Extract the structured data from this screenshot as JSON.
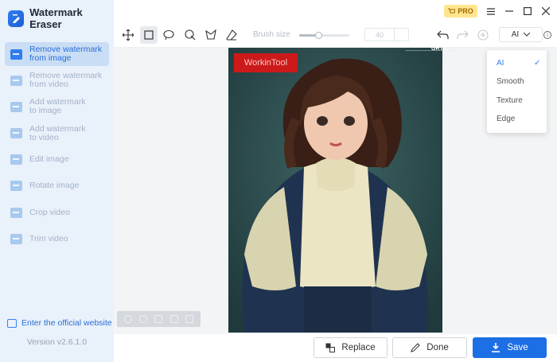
{
  "app": {
    "title": "Watermark Eraser",
    "version": "Version v2.6.1.0"
  },
  "sidebar": {
    "items": [
      {
        "label": "Remove watermark\nfrom image",
        "icon": "image-remove-icon",
        "active": true
      },
      {
        "label": "Remove watermark\nfrom video",
        "icon": "video-remove-icon",
        "active": false
      },
      {
        "label": "Add watermark\nto image",
        "icon": "image-add-icon",
        "active": false
      },
      {
        "label": "Add watermark\nto video",
        "icon": "video-add-icon",
        "active": false
      },
      {
        "label": "Edit image",
        "icon": "edit-image-icon",
        "active": false
      },
      {
        "label": "Rotate image",
        "icon": "rotate-image-icon",
        "active": false
      },
      {
        "label": "Crop video",
        "icon": "crop-video-icon",
        "active": false
      },
      {
        "label": "Trim video",
        "icon": "trim-video-icon",
        "active": false
      }
    ],
    "official_link": "Enter the official website"
  },
  "titlebar": {
    "pro_label": "PRO"
  },
  "toolbar": {
    "brush_label": "Brush size",
    "brush_value": "40",
    "brush_level": 0.38,
    "mode_value": "AI"
  },
  "dropdown": {
    "options": [
      "AI",
      "Smooth",
      "Texture",
      "Edge"
    ],
    "selected": "AI"
  },
  "image": {
    "watermark_text": "WorkinTool",
    "corner_small": "——————————",
    "corner_brand": "GRT"
  },
  "actions": {
    "replace": "Replace",
    "done": "Done",
    "save": "Save"
  },
  "colors": {
    "accent": "#1d6fe5",
    "pro": "#ffe58f",
    "watermark": "#cc1a1a"
  }
}
